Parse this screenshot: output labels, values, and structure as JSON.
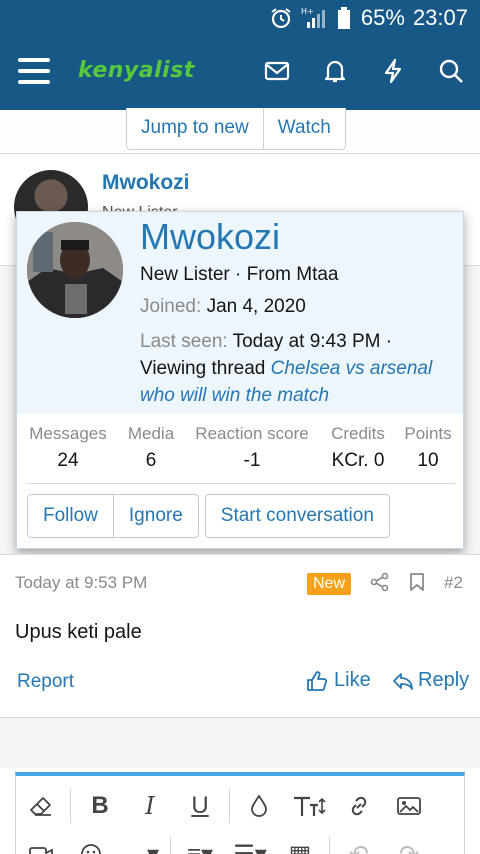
{
  "statusbar": {
    "battery_pct": "65%",
    "time": "23:07",
    "network": "H+"
  },
  "header": {
    "logo": "kenyalist",
    "icons": [
      "mail-icon",
      "bell-icon",
      "bolt-icon",
      "search-icon"
    ]
  },
  "thread_nav": {
    "jump_label": "Jump to new",
    "watch_label": "Watch"
  },
  "post1": {
    "author": "Mwokozi",
    "subtitle": "New Lister"
  },
  "member_card": {
    "name": "Mwokozi",
    "title": "New Lister · From Mtaa",
    "joined_label": "Joined:",
    "joined_value": "Jan 4, 2020",
    "last_seen_label": "Last seen:",
    "last_seen_value": "Today at 9:43 PM ·",
    "viewing_text": "Viewing thread",
    "viewing_link": "Chelsea vs arsenal who will win the match",
    "stats": [
      {
        "label": "Messages",
        "value": "24"
      },
      {
        "label": "Media",
        "value": "6"
      },
      {
        "label": "Reaction score",
        "value": "-1"
      },
      {
        "label": "Credits",
        "value": "KCr. 0"
      },
      {
        "label": "Points",
        "value": "10"
      }
    ],
    "follow_label": "Follow",
    "ignore_label": "Ignore",
    "conversation_label": "Start conversation"
  },
  "post2": {
    "time": "Today at 9:53 PM",
    "badge": "New",
    "number": "#2",
    "body": "Upus keti pale",
    "report_label": "Report",
    "like_label": "Like",
    "reply_label": "Reply"
  },
  "colors": {
    "header": "#185886",
    "link": "#2577b1",
    "logo": "#57c83b",
    "badge": "#f6a11a",
    "editor_accent": "#47a7eb"
  }
}
